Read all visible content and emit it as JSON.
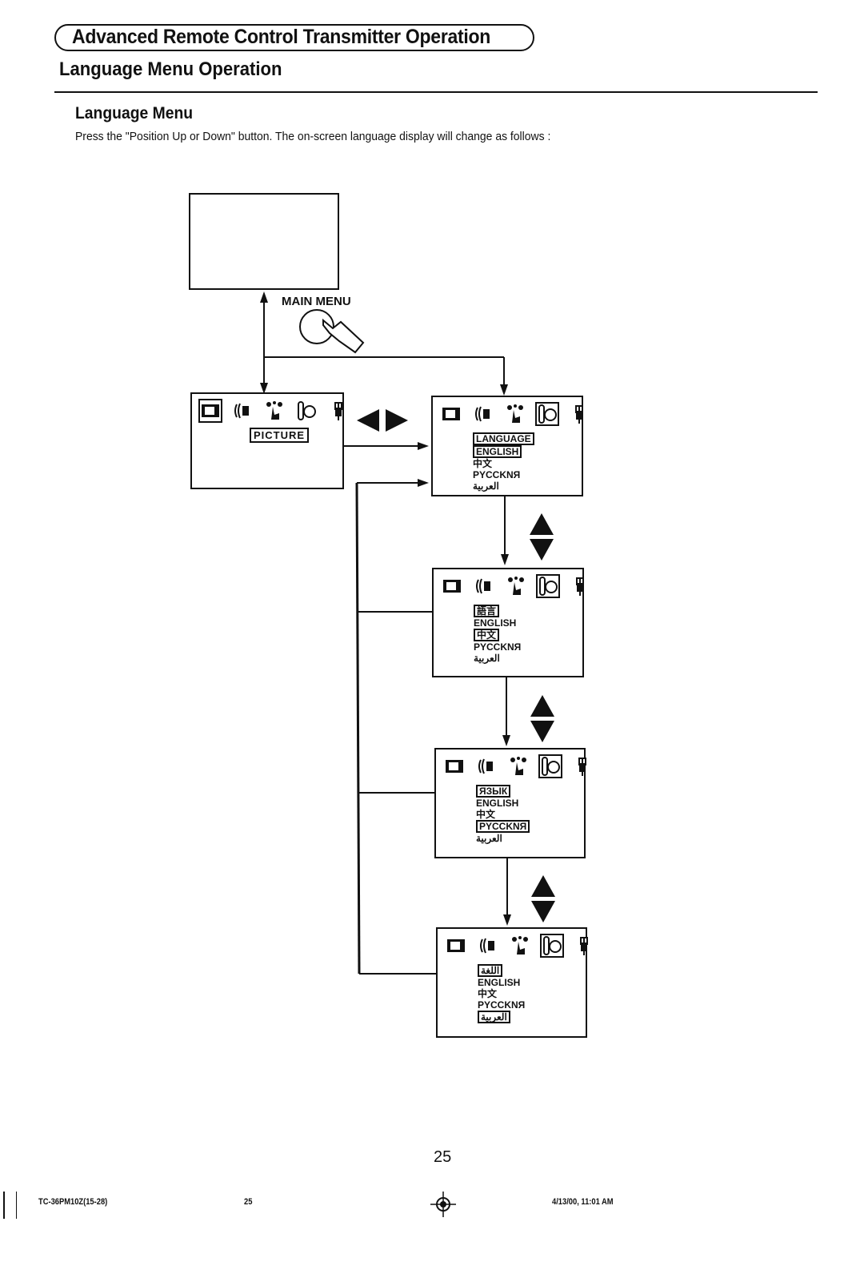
{
  "header": {
    "chapter_title": "Advanced Remote Control Transmitter Operation",
    "section_title": "Language Menu Operation"
  },
  "content": {
    "subtitle": "Language Menu",
    "instruction": "Press the \"Position Up or Down\" button. The on-screen language display will change as follows :"
  },
  "diagram": {
    "main_menu_button_label": "MAIN MENU",
    "left_right_arrows": "◀▶",
    "up_down_arrows": "▲▼",
    "menu_icons": [
      "picture-icon",
      "sound-icon",
      "setup-icon",
      "language-icon",
      "plug-icon"
    ],
    "picture_menu": {
      "selected_label": "PICTURE"
    },
    "language_screens": [
      {
        "title": "LANGUAGE",
        "items": [
          "ENGLISH",
          "中文",
          "PYCCKNЯ",
          "العربية"
        ],
        "selected": "ENGLISH",
        "title_highlighted": true
      },
      {
        "title": "語言",
        "items": [
          "ENGLISH",
          "中文",
          "PYCCKNЯ",
          "العربية"
        ],
        "selected": "中文",
        "title_highlighted": true
      },
      {
        "title": "ЯЗЫК",
        "items": [
          "ENGLISH",
          "中文",
          "PYCCKNЯ",
          "العربية"
        ],
        "selected": "PYCCKNЯ",
        "title_highlighted": true
      },
      {
        "title": "اللغة",
        "items": [
          "ENGLISH",
          "中文",
          "PYCCKNЯ",
          "العربية"
        ],
        "selected": "العربية",
        "title_highlighted": true
      }
    ]
  },
  "footer": {
    "page_number": "25",
    "doc_code": "TC-36PM10Z(15-28)",
    "doc_page": "25",
    "timestamp": "4/13/00, 11:01 AM"
  }
}
